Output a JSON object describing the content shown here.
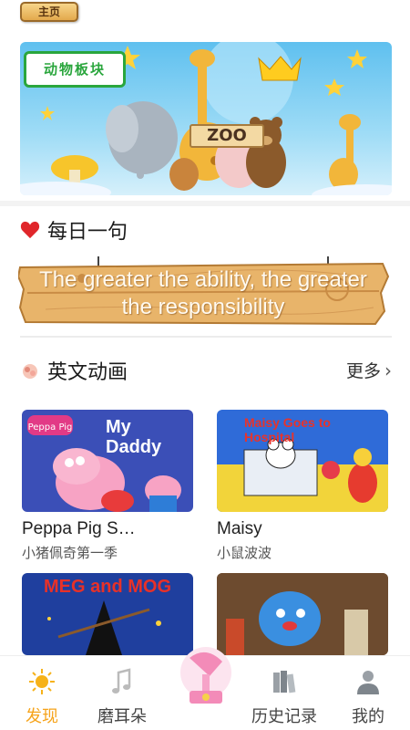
{
  "header": {
    "home_tag": "主页"
  },
  "banner": {
    "label": "动物板块",
    "sign": "ZOO"
  },
  "daily": {
    "title": "每日一句",
    "quote": "The greater the ability, the greater the responsibility"
  },
  "animation": {
    "title": "英文动画",
    "more_label": "更多",
    "items": [
      {
        "title": "Peppa Pig S…",
        "subtitle": "小猪佩奇第一季",
        "art_text": "My Daddy",
        "art_logo": "Peppa Pig"
      },
      {
        "title": "Maisy",
        "subtitle": "小鼠波波",
        "art_text": "Maisy Goes to Hospital"
      },
      {
        "title": "",
        "subtitle": "",
        "art_text": "MEG and MOG"
      },
      {
        "title": "",
        "subtitle": "",
        "art_text": ""
      }
    ]
  },
  "tabs": [
    {
      "label": "发现",
      "icon": "sun-icon",
      "active": true
    },
    {
      "label": "磨耳朵",
      "icon": "music-note-icon",
      "active": false
    },
    {
      "label": "",
      "icon": "gramophone-icon",
      "active": false
    },
    {
      "label": "历史记录",
      "icon": "books-icon",
      "active": false
    },
    {
      "label": "我的",
      "icon": "user-icon",
      "active": false
    }
  ],
  "colors": {
    "accent": "#f6a31a",
    "banner_green": "#2aa63d",
    "heart": "#e0262b"
  }
}
